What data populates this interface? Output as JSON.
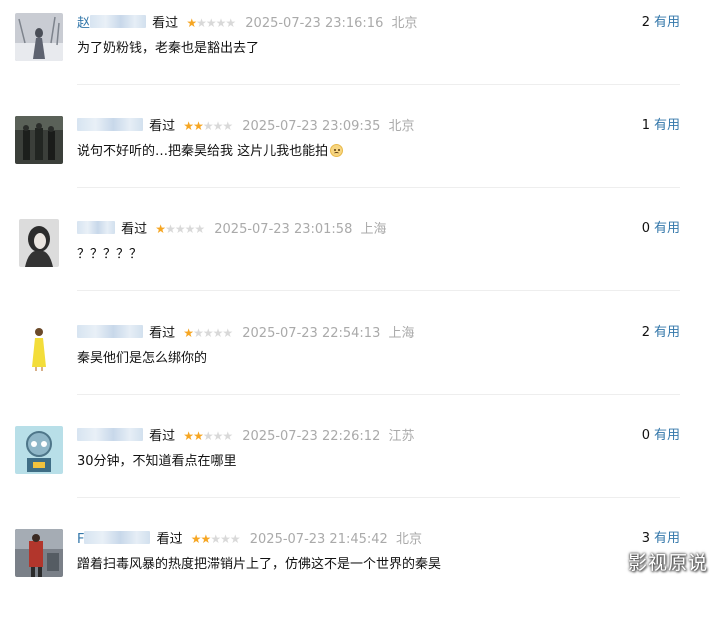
{
  "comments": [
    {
      "username": "赵",
      "watched_label": "看过",
      "rating": 1,
      "time": "2025-07-23 23:16:16",
      "location": "北京",
      "votes": "2",
      "useful_label": "有用",
      "text": "为了奶粉钱，老秦也是豁出去了"
    },
    {
      "username": "",
      "watched_label": "看过",
      "rating": 2,
      "time": "2025-07-23 23:09:35",
      "location": "北京",
      "votes": "1",
      "useful_label": "有用",
      "text": "说句不好听的…把秦昊给我 这片儿我也能拍"
    },
    {
      "username": "",
      "watched_label": "看过",
      "rating": 1,
      "time": "2025-07-23 23:01:58",
      "location": "上海",
      "votes": "0",
      "useful_label": "有用",
      "text": "？？？？？"
    },
    {
      "username": "",
      "watched_label": "看过",
      "rating": 1,
      "time": "2025-07-23 22:54:13",
      "location": "上海",
      "votes": "2",
      "useful_label": "有用",
      "text": "秦昊他们是怎么绑你的"
    },
    {
      "username": "",
      "watched_label": "看过",
      "rating": 2,
      "time": "2025-07-23 22:26:12",
      "location": "江苏",
      "votes": "0",
      "useful_label": "有用",
      "text": "30分钟，不知道看点在哪里"
    },
    {
      "username": "F",
      "watched_label": "看过",
      "rating": 2,
      "time": "2025-07-23 21:45:42",
      "location": "北京",
      "votes": "3",
      "useful_label": "有用",
      "text": "蹭着扫毒风暴的热度把滞销片上了，仿佛这不是一个世界的秦昊"
    }
  ],
  "colors": {
    "link": "#3377aa",
    "star": "#f6a623",
    "muted": "#aaaaaa"
  },
  "watermark": "影视原说"
}
